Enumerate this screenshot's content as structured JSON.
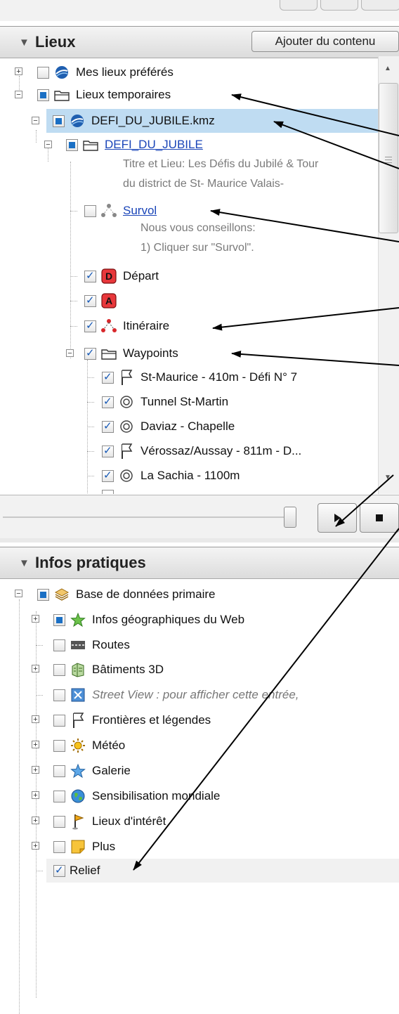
{
  "places_panel": {
    "title": "Lieux",
    "add_content_label": "Ajouter du contenu",
    "items": [
      {
        "label": "Mes lieux préférés"
      },
      {
        "label": "Lieux temporaires"
      },
      {
        "label": "DEFI_DU_JUBILE.kmz"
      },
      {
        "label": "DEFI_DU_JUBILE",
        "description_lines": [
          "Titre et Lieu: Les Défis du Jubilé & Tour",
          "du district de St- Maurice Valais-"
        ]
      },
      {
        "label": "Survol",
        "description_lines": [
          "Nous vous conseillons:",
          "1) Cliquer sur \"Survol\"."
        ]
      },
      {
        "label": "Départ",
        "badge": "D"
      },
      {
        "label": "",
        "badge": "A"
      },
      {
        "label": "Itinéraire"
      },
      {
        "label": "Waypoints"
      },
      {
        "label": "St-Maurice - 410m - Défi N° 7"
      },
      {
        "label": "Tunnel St-Martin"
      },
      {
        "label": "Daviaz - Chapelle"
      },
      {
        "label": "Vérossaz/Aussay - 811m - D..."
      },
      {
        "label": "La Sachia - 1100m"
      }
    ]
  },
  "tour_controls": {
    "play_icon": "play-icon",
    "stop_icon": "stop-icon"
  },
  "layers_panel": {
    "title": "Infos pratiques",
    "items": [
      {
        "label": "Base de données primaire"
      },
      {
        "label": "Infos géographiques du Web"
      },
      {
        "label": "Routes"
      },
      {
        "label": "Bâtiments 3D"
      },
      {
        "label": "Street View : pour afficher cette entrée,"
      },
      {
        "label": "Frontières et légendes"
      },
      {
        "label": "Météo"
      },
      {
        "label": "Galerie"
      },
      {
        "label": "Sensibilisation mondiale"
      },
      {
        "label": "Lieux d'intérêt"
      },
      {
        "label": "Plus"
      },
      {
        "label": "Relief"
      }
    ]
  },
  "colors": {
    "selection": "#bfdcf2",
    "link": "#1a45b8",
    "badge_red": "#e8373b"
  }
}
